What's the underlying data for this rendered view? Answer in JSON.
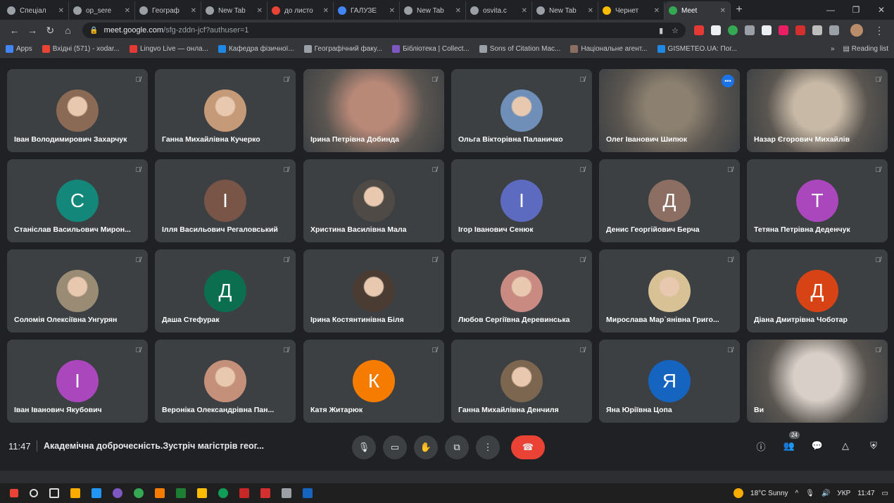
{
  "tabs": [
    {
      "label": "Спеціал",
      "color": "#9aa0a6"
    },
    {
      "label": "op_sere",
      "color": "#9aa0a6"
    },
    {
      "label": "Географ",
      "color": "#9aa0a6"
    },
    {
      "label": "New Tab",
      "color": "#9aa0a6"
    },
    {
      "label": "до листо",
      "color": "#ea4335"
    },
    {
      "label": "ГАЛУЗЕ",
      "color": "#4285f4"
    },
    {
      "label": "New Tab",
      "color": "#9aa0a6"
    },
    {
      "label": "osvita.c",
      "color": "#9aa0a6"
    },
    {
      "label": "New Tab",
      "color": "#9aa0a6"
    },
    {
      "label": "Чернет",
      "color": "#fbbc04"
    },
    {
      "label": "Meet",
      "color": "#34a853"
    }
  ],
  "address": {
    "host": "meet.google.com",
    "path": "/sfg-zddn-jcf?authuser=1"
  },
  "bookmarks": [
    {
      "label": "Apps",
      "color": "#4285f4"
    },
    {
      "label": "Вхідні (571) - xodar...",
      "color": "#ea4335"
    },
    {
      "label": "Lingvo Live — онла...",
      "color": "#e53935"
    },
    {
      "label": "Кафедра фізичної...",
      "color": "#1e88e5"
    },
    {
      "label": "Географічний факу...",
      "color": "#9aa0a6"
    },
    {
      "label": "Бібліотека | Collect...",
      "color": "#7e57c2"
    },
    {
      "label": "Sons of Citation Mac...",
      "color": "#9aa0a6"
    },
    {
      "label": "Національне агент...",
      "color": "#8d6e63"
    },
    {
      "label": "GISMETEO.UA: Пог...",
      "color": "#1e88e5"
    }
  ],
  "reading_list": "Reading list",
  "participants": [
    {
      "name": "Іван Володимирович Захарчук",
      "type": "photo",
      "color": "#8a6a55"
    },
    {
      "name": "Ганна Михайлівна Кучерко",
      "type": "photo",
      "color": "#c49a78"
    },
    {
      "name": "Ірина Петрівна Добинда",
      "type": "video",
      "color": "#b98978"
    },
    {
      "name": "Ольга Вікторівна Паланичко",
      "type": "photo",
      "color": "#6f8fb8"
    },
    {
      "name": "Олег Іванович Шипюк",
      "type": "video",
      "color": "#8c8170"
    },
    {
      "name": "Назар Єгорович Михайлів",
      "type": "video",
      "color": "#c8b9a6"
    },
    {
      "name": "Станіслав Васильович Мирон...",
      "type": "letter",
      "letter": "С",
      "color": "#12877a"
    },
    {
      "name": "Ілля Васильович Регаловський",
      "type": "letter",
      "letter": "І",
      "color": "#795548"
    },
    {
      "name": "Христина Василівна Мала",
      "type": "photo",
      "color": "#4f4a45"
    },
    {
      "name": "Ігор Іванович Сенюк",
      "type": "letter",
      "letter": "І",
      "color": "#5c6bc0"
    },
    {
      "name": "Денис Георгійович Берча",
      "type": "letter",
      "letter": "Д",
      "color": "#8d6e63"
    },
    {
      "name": "Тетяна Петрівна Деденчук",
      "type": "letter",
      "letter": "Т",
      "color": "#ab47bc"
    },
    {
      "name": "Соломія Олексіївна Унгурян",
      "type": "photo",
      "color": "#9a8b75"
    },
    {
      "name": "Даша Стефурак",
      "type": "letter",
      "letter": "Д",
      "color": "#0b6e4f"
    },
    {
      "name": "Ірина Костянтинівна Біля",
      "type": "photo",
      "color": "#4a3b33"
    },
    {
      "name": "Любов Сергіївна Деревинська",
      "type": "photo",
      "color": "#c98a82"
    },
    {
      "name": "Мирослава Мар`янівна Григо...",
      "type": "photo",
      "color": "#d9c196"
    },
    {
      "name": "Діана Дмитрівна Чоботар",
      "type": "letter",
      "letter": "Д",
      "color": "#d84315"
    },
    {
      "name": "Іван Іванович Якубович",
      "type": "letter",
      "letter": "І",
      "color": "#ab47bc"
    },
    {
      "name": "Вероніка Олександрівна Пан...",
      "type": "photo",
      "color": "#c5907a"
    },
    {
      "name": "Катя Житарюк",
      "type": "letter",
      "letter": "К",
      "color": "#f57c00"
    },
    {
      "name": "Ганна Михайлівна Денчиля",
      "type": "photo",
      "color": "#7d6650"
    },
    {
      "name": "Яна Юріївна Цопа",
      "type": "letter",
      "letter": "Я",
      "color": "#1565c0"
    },
    {
      "name": "Ви",
      "type": "video",
      "color": "#d8cfc8"
    }
  ],
  "bottom": {
    "clock": "11:47",
    "title": "Академічна доброчесність.Зустріч магістрів геог...",
    "people_count": "24"
  },
  "taskbar": {
    "weather": "18°C Sunny",
    "lang": "УКР",
    "time": "11:47"
  }
}
